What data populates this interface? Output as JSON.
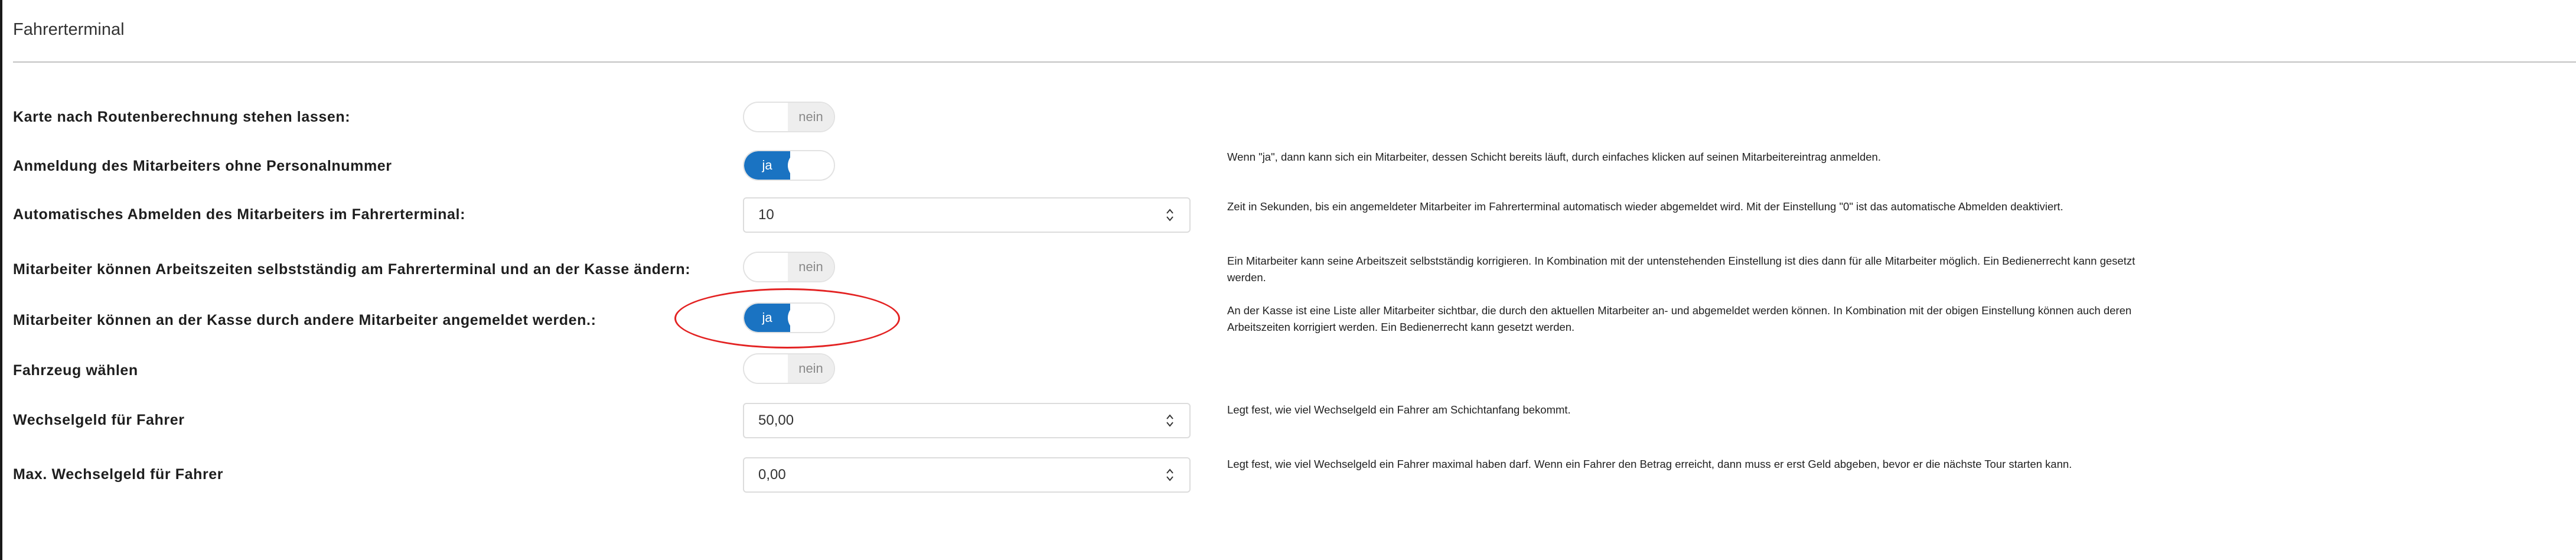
{
  "section": {
    "title": "Fahrerterminal"
  },
  "settings": [
    {
      "label": "Karte nach Routenberechnung stehen lassen:",
      "control": "toggle",
      "state": "off",
      "text": "nein",
      "help": ""
    },
    {
      "label": "Anmeldung des Mitarbeiters ohne Personalnummer",
      "control": "toggle",
      "state": "on",
      "text": "ja",
      "help": "Wenn \"ja\", dann kann sich ein Mitarbeiter, dessen Schicht bereits läuft, durch einfaches klicken auf seinen Mitarbeitereintrag anmelden."
    },
    {
      "label": "Automatisches Abmelden des Mitarbeiters im Fahrerterminal:",
      "control": "number",
      "value": "10",
      "help": "Zeit in Sekunden, bis ein angemeldeter Mitarbeiter im Fahrerterminal automatisch wieder abgemeldet wird. Mit der Einstellung \"0\" ist das automatische Abmelden deaktiviert."
    },
    {
      "label": "Mitarbeiter können Arbeitszeiten selbstständig am Fahrerterminal und an der Kasse ändern:",
      "control": "toggle",
      "state": "off",
      "text": "nein",
      "help": "Ein Mitarbeiter kann seine Arbeitszeit selbstständig korrigieren. In Kombination mit der untenstehenden Einstellung ist dies dann für alle Mitarbeiter möglich. Ein Bedienerrecht kann gesetzt werden."
    },
    {
      "label": "Mitarbeiter können an der Kasse durch andere Mitarbeiter angemeldet werden.:",
      "control": "toggle",
      "state": "on",
      "text": "ja",
      "help": "An der Kasse ist eine Liste aller Mitarbeiter sichtbar, die durch den aktuellen Mitarbeiter an- und abgemeldet werden können. In Kombination mit der obigen Einstellung können auch deren Arbeitszeiten korrigiert werden. Ein Bedienerrecht kann gesetzt werden."
    },
    {
      "label": "Fahrzeug wählen",
      "control": "toggle",
      "state": "off",
      "text": "nein",
      "help": ""
    },
    {
      "label": "Wechselgeld für Fahrer",
      "control": "number",
      "value": "50,00",
      "help": "Legt fest, wie viel Wechselgeld ein Fahrer am Schichtanfang bekommt."
    },
    {
      "label": "Max. Wechselgeld für Fahrer",
      "control": "number",
      "value": "0,00",
      "help": "Legt fest, wie viel Wechselgeld ein Fahrer maximal haben darf. Wenn ein Fahrer den Betrag erreicht, dann muss er erst Geld abgeben, bevor er die nächste Tour starten kann."
    }
  ],
  "colors": {
    "toggle_on": "#1a73c2",
    "highlight": "#e32222",
    "divider": "#c2c2c2"
  }
}
